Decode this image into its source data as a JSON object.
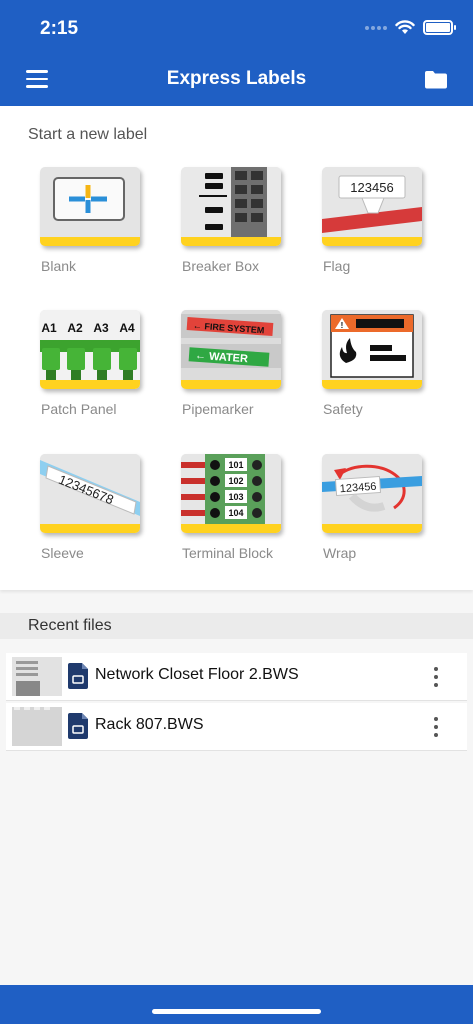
{
  "status_bar": {
    "time": "2:15"
  },
  "header": {
    "title": "Express Labels"
  },
  "new_label": {
    "heading": "Start a new label",
    "tiles": [
      {
        "label": "Blank",
        "icon": "blank-label-icon"
      },
      {
        "label": "Breaker Box",
        "icon": "breaker-box-icon"
      },
      {
        "label": "Flag",
        "icon": "flag-label-icon",
        "sample": "123456"
      },
      {
        "label": "Patch Panel",
        "icon": "patch-panel-icon",
        "ports": [
          "A1",
          "A2",
          "A3",
          "A4"
        ]
      },
      {
        "label": "Pipemarker",
        "icon": "pipemarker-icon",
        "markers": [
          "FIRE SYSTEM",
          "WATER"
        ]
      },
      {
        "label": "Safety",
        "icon": "safety-label-icon"
      },
      {
        "label": "Sleeve",
        "icon": "sleeve-label-icon",
        "sample": "12345678"
      },
      {
        "label": "Terminal Block",
        "icon": "terminal-block-icon",
        "terminals": [
          "101",
          "102",
          "103",
          "104"
        ]
      },
      {
        "label": "Wrap",
        "icon": "wrap-label-icon",
        "sample": "123456"
      }
    ]
  },
  "recent": {
    "heading": "Recent files",
    "files": [
      {
        "name": "Network Closet Floor 2.BWS"
      },
      {
        "name": "Rack 807.BWS"
      }
    ]
  },
  "colors": {
    "brand_blue": "#1f5fc4",
    "accent_yellow": "#ffd21f"
  }
}
